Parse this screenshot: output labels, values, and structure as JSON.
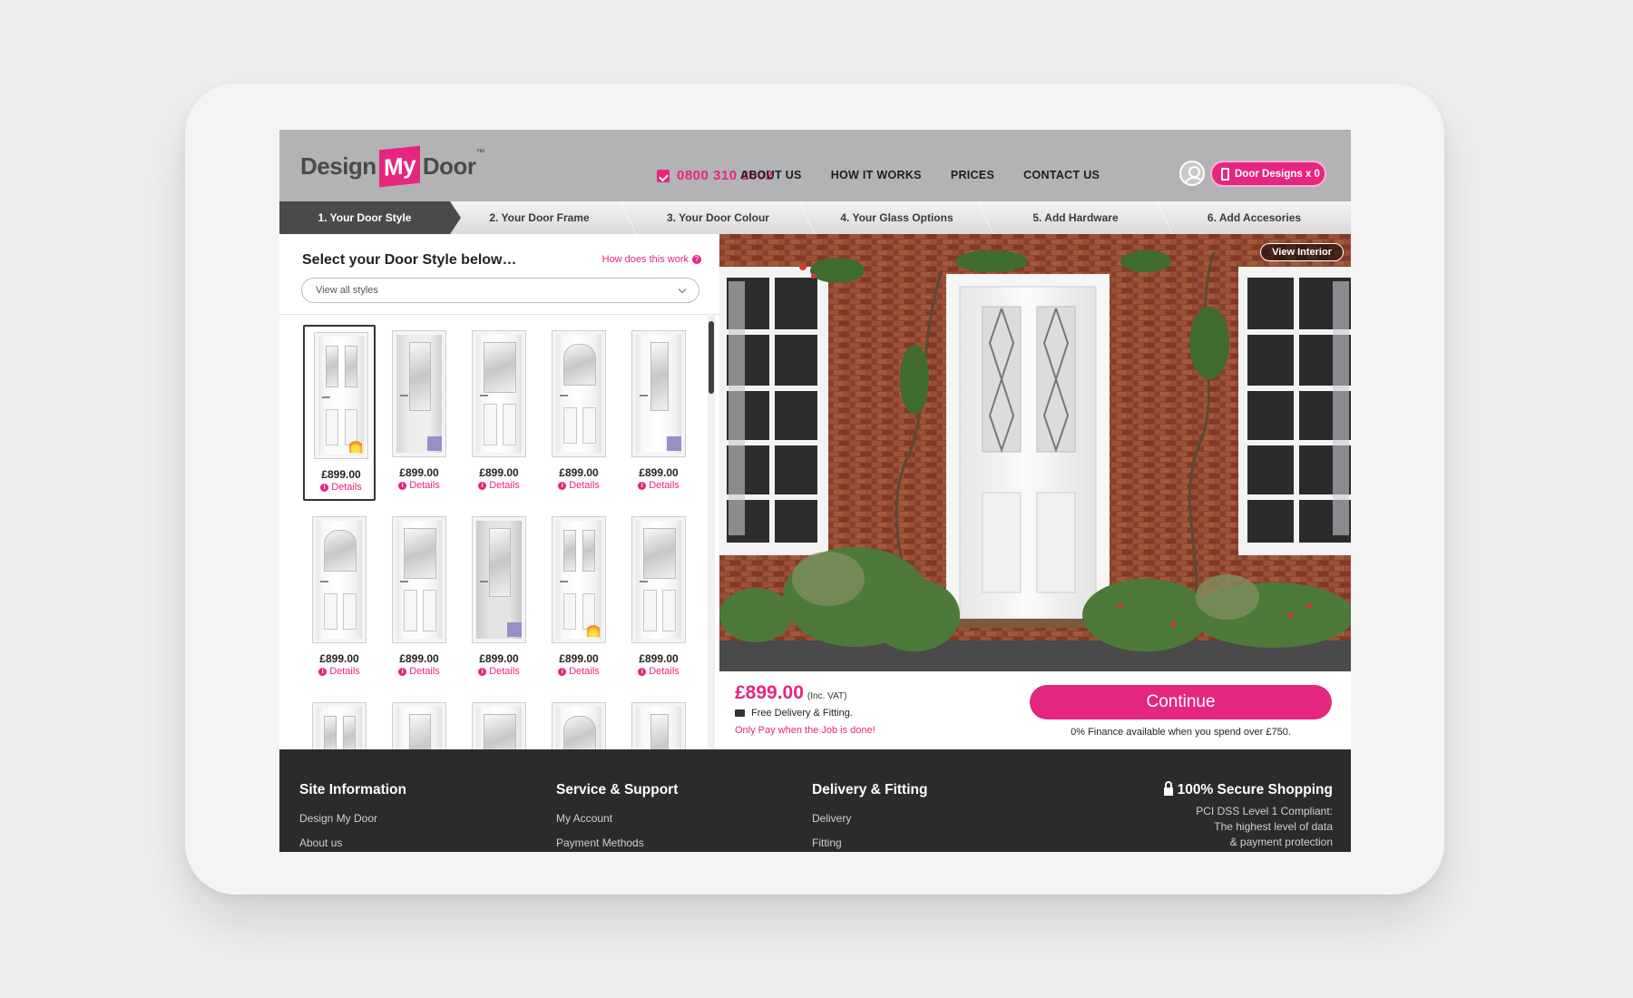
{
  "logo": {
    "pre": "Design",
    "my": "My",
    "post": "Door",
    "tm": "™"
  },
  "header": {
    "phone": "0800 310 2002",
    "nav": [
      "ABOUT US",
      "HOW IT WORKS",
      "PRICES",
      "CONTACT US"
    ],
    "door_designs": "Door Designs x 0"
  },
  "steps": [
    "1.  Your Door Style",
    "2.  Your Door Frame",
    "3.  Your Door Colour",
    "4.  Your Glass Options",
    "5.  Add Hardware",
    "6.  Add Accesories"
  ],
  "selector": {
    "title": "Select your Door Style below…",
    "help": "How does this work",
    "dropdown": "View all styles"
  },
  "doors": [
    {
      "price": "£899.00",
      "details": "Details",
      "badge": "fire"
    },
    {
      "price": "£899.00",
      "details": "Details",
      "badge": "secure"
    },
    {
      "price": "£899.00",
      "details": "Details",
      "badge": ""
    },
    {
      "price": "£899.00",
      "details": "Details",
      "badge": ""
    },
    {
      "price": "£899.00",
      "details": "Details",
      "badge": "secure"
    },
    {
      "price": "£899.00",
      "details": "Details",
      "badge": ""
    },
    {
      "price": "£899.00",
      "details": "Details",
      "badge": ""
    },
    {
      "price": "£899.00",
      "details": "Details",
      "badge": "secure"
    },
    {
      "price": "£899.00",
      "details": "Details",
      "badge": "fire"
    },
    {
      "price": "£899.00",
      "details": "Details",
      "badge": ""
    }
  ],
  "preview": {
    "view_interior": "View Interior"
  },
  "pricing": {
    "price": "£899.00",
    "vat": "(Inc. VAT)",
    "delivery": "Free Delivery & Fitting.",
    "pay": "Only Pay when the Job is done!",
    "continue": "Continue",
    "finance": "0% Finance available when you spend over £750."
  },
  "footer": {
    "site": {
      "title": "Site Information",
      "links": [
        "Design My Door",
        "About us"
      ]
    },
    "service": {
      "title": "Service & Support",
      "links": [
        "My Account",
        "Payment Methods"
      ]
    },
    "delivery": {
      "title": "Delivery & Fitting",
      "links": [
        "Delivery",
        "Fitting"
      ]
    },
    "secure": {
      "title": "100% Secure Shopping",
      "lines": [
        "PCI DSS Level 1 Compliant:",
        "The highest level of data",
        "& payment protection"
      ]
    }
  },
  "colors": {
    "brand": "#e5267f",
    "header_bg": "#b2b3b5",
    "footer_bg": "#2d2a2b"
  },
  "icons": [
    "phone-icon",
    "account-icon",
    "door-icon",
    "help-icon",
    "chevron-down-icon",
    "info-icon",
    "truck-icon",
    "lock-icon"
  ]
}
